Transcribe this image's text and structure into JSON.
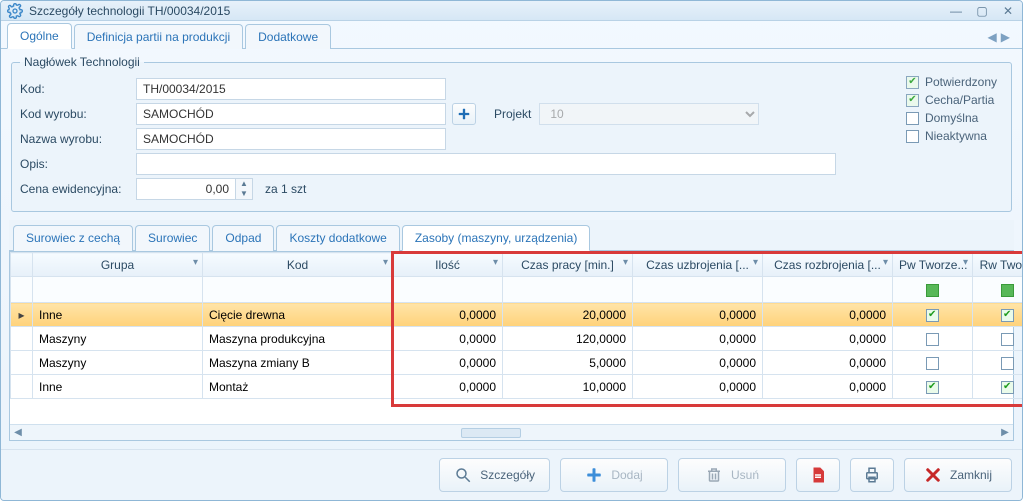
{
  "window": {
    "title": "Szczegóły technologii TH/00034/2015"
  },
  "tabs": {
    "items": [
      {
        "label": "Ogólne",
        "active": true
      },
      {
        "label": "Definicja partii na produkcji",
        "active": false
      },
      {
        "label": "Dodatkowe",
        "active": false
      }
    ]
  },
  "header": {
    "legend": "Nagłówek Technologii",
    "labels": {
      "kod": "Kod:",
      "kod_wyrobu": "Kod wyrobu:",
      "nazwa_wyrobu": "Nazwa wyrobu:",
      "opis": "Opis:",
      "cena": "Cena ewidencyjna:",
      "projekt": "Projekt",
      "unit": "za 1 szt"
    },
    "values": {
      "kod": "TH/00034/2015",
      "kod_wyrobu": "SAMOCHÓD",
      "nazwa_wyrobu": "SAMOCHÓD",
      "opis": "",
      "cena": "0,00",
      "projekt": "10"
    },
    "checks": {
      "potwierdzony": {
        "label": "Potwierdzony",
        "on": true,
        "locked": true
      },
      "cecha": {
        "label": "Cecha/Partia",
        "on": true,
        "locked": true
      },
      "domyslna": {
        "label": "Domyślna",
        "on": false,
        "locked": false
      },
      "nieaktywna": {
        "label": "Nieaktywna",
        "on": false,
        "locked": false
      }
    }
  },
  "subtabs": {
    "items": [
      {
        "label": "Surowiec z cechą",
        "active": false
      },
      {
        "label": "Surowiec",
        "active": false
      },
      {
        "label": "Odpad",
        "active": false
      },
      {
        "label": "Koszty dodatkowe",
        "active": false
      },
      {
        "label": "Zasoby (maszyny, urządzenia)",
        "active": true
      }
    ]
  },
  "grid": {
    "columns": [
      {
        "label": "",
        "key": "mark"
      },
      {
        "label": "Grupa",
        "key": "grupa"
      },
      {
        "label": "Kod",
        "key": "kod"
      },
      {
        "label": "Ilość",
        "key": "ilosc"
      },
      {
        "label": "Czas pracy [min.]",
        "key": "czas_pracy"
      },
      {
        "label": "Czas uzbrojenia [...",
        "key": "czas_uz"
      },
      {
        "label": "Czas rozbrojenia [...",
        "key": "czas_roz"
      },
      {
        "label": "Pw Tworze...",
        "key": "pw"
      },
      {
        "label": "Rw Twor...",
        "key": "rw"
      }
    ],
    "rows": [
      {
        "sel": true,
        "grupa": "Inne",
        "kod": "Cięcie drewna",
        "ilosc": "0,0000",
        "czas_pracy": "20,0000",
        "czas_uz": "0,0000",
        "czas_roz": "0,0000",
        "pw": true,
        "rw": true
      },
      {
        "sel": false,
        "grupa": "Maszyny",
        "kod": "Maszyna produkcyjna",
        "ilosc": "0,0000",
        "czas_pracy": "120,0000",
        "czas_uz": "0,0000",
        "czas_roz": "0,0000",
        "pw": false,
        "rw": false
      },
      {
        "sel": false,
        "grupa": "Maszyny",
        "kod": "Maszyna zmiany B",
        "ilosc": "0,0000",
        "czas_pracy": "5,0000",
        "czas_uz": "0,0000",
        "czas_roz": "0,0000",
        "pw": false,
        "rw": false
      },
      {
        "sel": false,
        "grupa": "Inne",
        "kod": "Montaż",
        "ilosc": "0,0000",
        "czas_pracy": "10,0000",
        "czas_uz": "0,0000",
        "czas_roz": "0,0000",
        "pw": true,
        "rw": true
      }
    ]
  },
  "footer": {
    "szczegoly": "Szczegóły",
    "dodaj": "Dodaj",
    "usun": "Usuń",
    "zamknij": "Zamknij"
  }
}
